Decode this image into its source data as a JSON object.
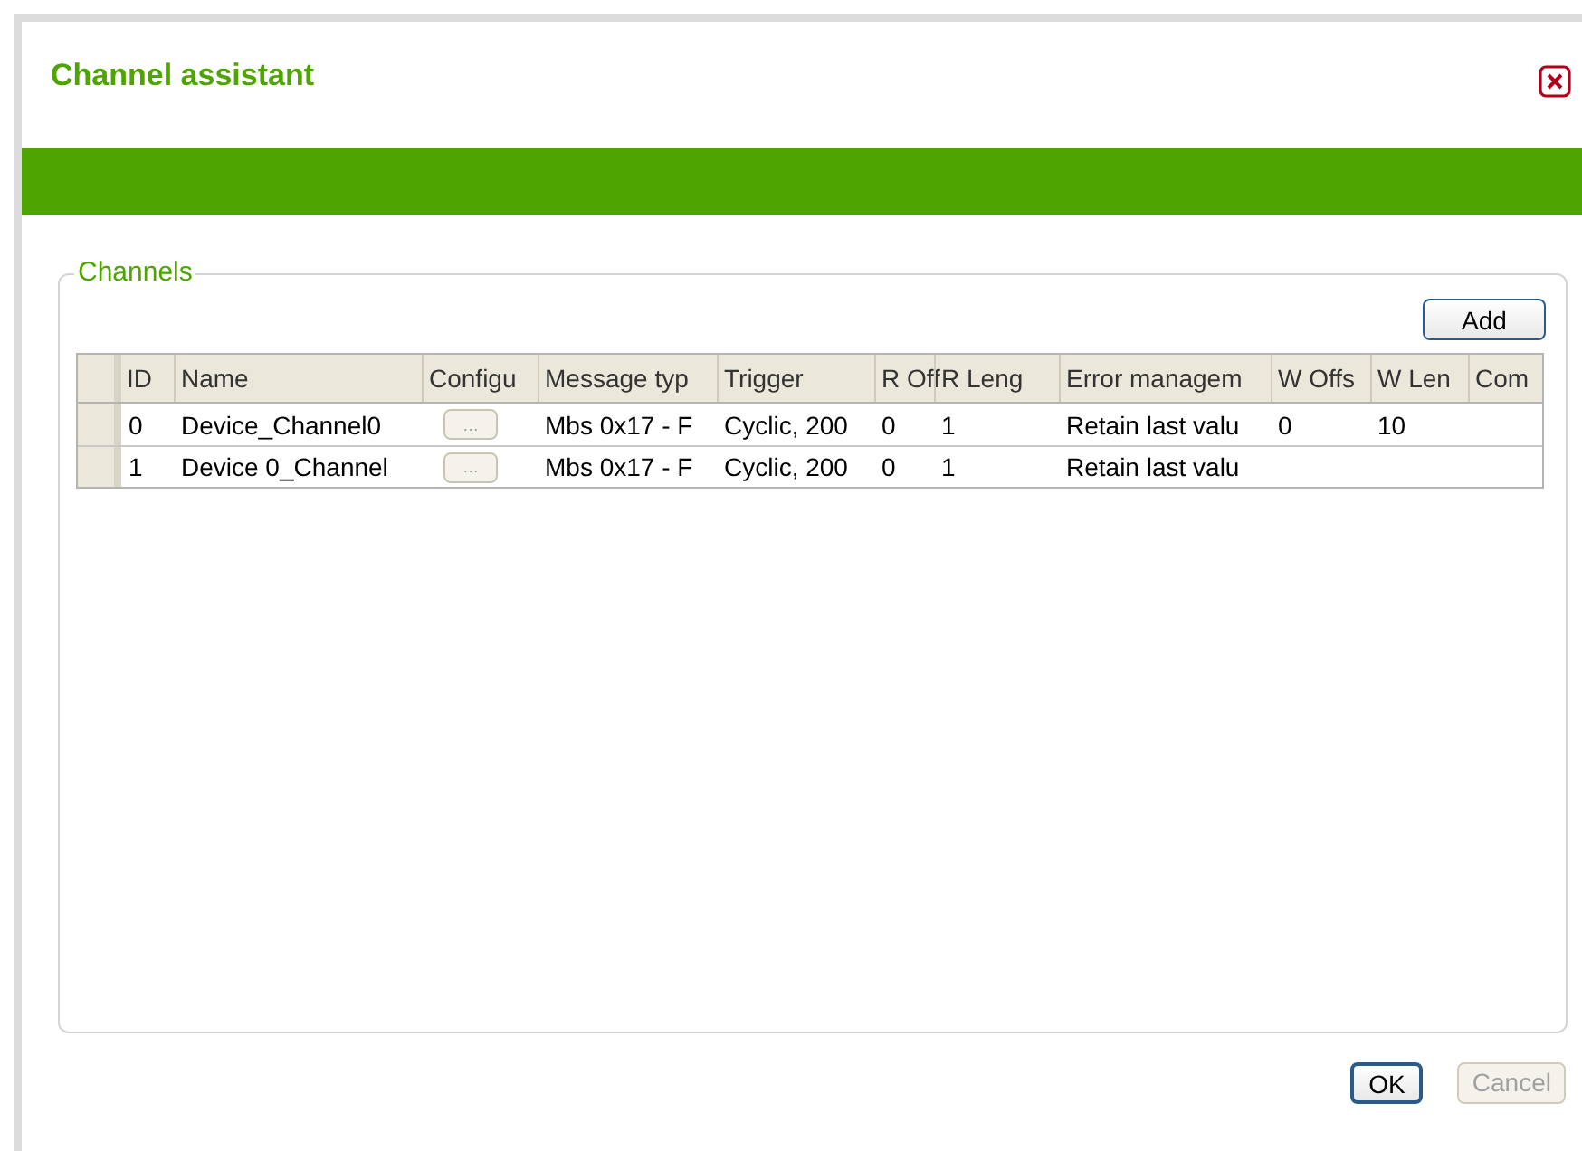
{
  "window": {
    "title": "Channel assistant"
  },
  "group": {
    "title": "Channels"
  },
  "add_button": "Add",
  "table": {
    "columns": [
      "ID",
      "Name",
      "Configu",
      "Message typ",
      "Trigger",
      "R Off",
      "R Leng",
      "Error managem",
      "W Offs",
      "W Len",
      "Com"
    ],
    "rows": [
      {
        "cells": [
          "0",
          "Device_Channel0",
          "…",
          "Mbs 0x17 - F",
          "Cyclic, 200",
          "0",
          "1",
          "Retain last valu",
          "0",
          "10",
          ""
        ]
      },
      {
        "cells": [
          "1",
          "Device 0_Channel",
          "…",
          "Mbs 0x17 - F",
          "Cyclic, 200",
          "0",
          "1",
          "Retain last valu",
          "",
          "",
          ""
        ]
      }
    ]
  },
  "buttons": [
    {
      "label": "OK",
      "disabled": false
    },
    {
      "label": "Cancel",
      "disabled": true
    }
  ]
}
